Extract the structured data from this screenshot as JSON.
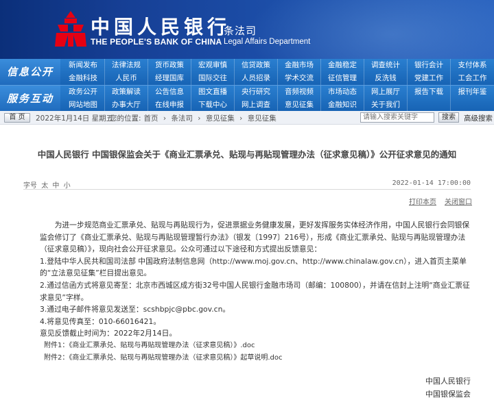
{
  "header": {
    "bank_cn": "中国人民银行",
    "bank_en": "THE PEOPLE'S BANK OF CHINA",
    "dept_cn": "条法司",
    "dept_en": "Legal Affairs Department"
  },
  "nav": {
    "group1": {
      "title": "信息公开",
      "items": [
        "新闻发布",
        "法律法规",
        "货币政策",
        "宏观审慎",
        "信贷政策",
        "金融市场",
        "金融稳定",
        "调查统计",
        "银行会计",
        "支付体系",
        "金融科技",
        "人民币",
        "经理国库",
        "国际交往",
        "人员招录",
        "学术交流",
        "征信管理",
        "反洗钱",
        "党建工作",
        "工会工作"
      ]
    },
    "group2": {
      "title": "服务互动",
      "items": [
        "政务公开",
        "政策解读",
        "公告信息",
        "图文直播",
        "央行研究",
        "音频视频",
        "市场动态",
        "网上展厅",
        "报告下载",
        "报刊年鉴",
        "网站地图",
        "办事大厅",
        "在线申报",
        "下载中心",
        "网上调查",
        "意见征集",
        "金融知识",
        "关于我们",
        "",
        ""
      ]
    }
  },
  "breadcrumb": {
    "home": "首 页",
    "date": "2022年1月14日 星期五",
    "location_label": "您的位置:",
    "path": [
      "首页",
      "条法司",
      "意见征集",
      "意见征集"
    ],
    "separator": "›",
    "search_placeholder": "请输入搜索关键字",
    "search_button": "搜索",
    "advanced_search": "高级搜索"
  },
  "article": {
    "title": "中国人民银行 中国银保监会关于《商业汇票承兑、贴现与再贴现管理办法（征求意见稿）》公开征求意见的通知",
    "font_size_label": "字号",
    "font_sizes": [
      "太",
      "中",
      "小"
    ],
    "date": "2022-01-14 17:00:00",
    "print": "打印本页",
    "close": "关闭窗口",
    "paragraphs": [
      "为进一步规范商业汇票承兑、贴现与再贴现行为，促进票据业务健康发展，更好发挥服务实体经济作用，中国人民银行会同银保监会修订了《商业汇票承兑、贴现与再贴现管理暂行办法》（银发〔1997〕216号），形成《商业汇票承兑、贴现与再贴现管理办法（征求意见稿）》，现向社会公开征求意见。公众可通过以下途径和方式提出反馈意见：",
      "1.登陆中华人民共和国司法部 中国政府法制信息网（http://www.moj.gov.cn、http://www.chinalaw.gov.cn），进入首页主菜单的“立法意见征集”栏目提出意见。",
      "2.通过信函方式将意见寄至：北京市西城区成方街32号中国人民银行金融市场司（邮编：100800），并请在信封上注明“商业汇票征求意见”字样。",
      "3.通过电子邮件将意见发送至：scshbpjc@pbc.gov.cn。",
      "4.将意见传真至：010-66016421。",
      "意见反馈截止时间为：2022年2月14日。"
    ],
    "attachments": [
      "附件1：《商业汇票承兑、贴现与再贴现管理办法（征求意见稿）》.doc",
      "附件2：《商业汇票承兑、贴现与再贴现管理办法（征求意见稿）》起草说明.doc"
    ],
    "signatures": [
      "中国人民银行",
      "中国银保监会"
    ]
  }
}
